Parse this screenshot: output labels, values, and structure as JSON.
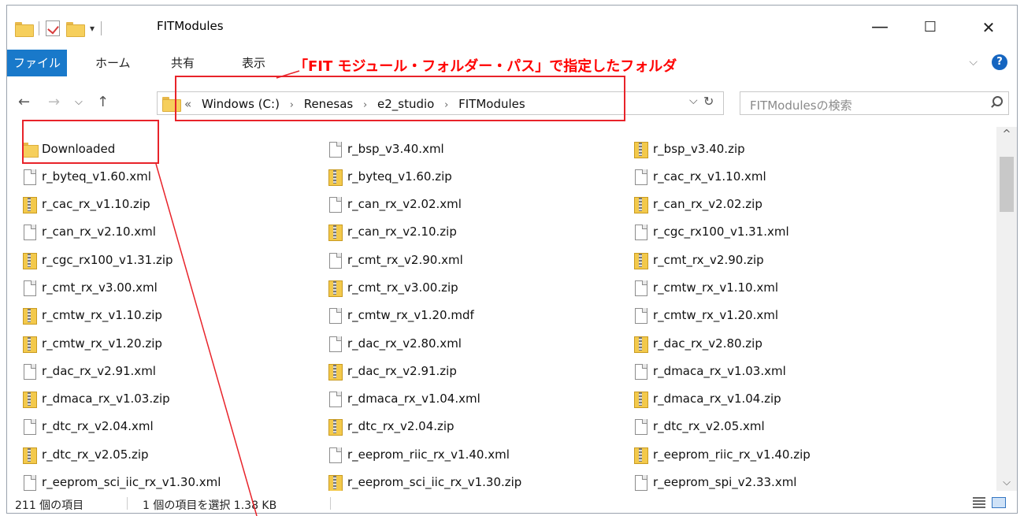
{
  "window": {
    "title": "FITModules",
    "qat_dropdown": "▾",
    "minimize": "—",
    "maximize": "☐",
    "close": "✕"
  },
  "ribbon": {
    "tabs": [
      "ファイル",
      "ホーム",
      "共有",
      "表示"
    ],
    "expand": "⌵",
    "help": "?"
  },
  "nav": {
    "back": "←",
    "forward": "→",
    "recent": "⌵",
    "up": "↑",
    "overflow": "«",
    "crumbs": [
      "Windows (C:)",
      "Renesas",
      "e2_studio",
      "FITModules"
    ],
    "crumb_sep": "›",
    "addr_dropdown": "⌵",
    "refresh": "↻"
  },
  "search": {
    "placeholder": "FITModulesの検索"
  },
  "files": [
    {
      "name": "Downloaded",
      "type": "folder"
    },
    {
      "name": "r_bsp_v3.40.xml",
      "type": "xml"
    },
    {
      "name": "r_bsp_v3.40.zip",
      "type": "zip"
    },
    {
      "name": "r_byteq_v1.60.xml",
      "type": "xml"
    },
    {
      "name": "r_byteq_v1.60.zip",
      "type": "zip"
    },
    {
      "name": "r_cac_rx_v1.10.xml",
      "type": "xml"
    },
    {
      "name": "r_cac_rx_v1.10.zip",
      "type": "zip"
    },
    {
      "name": "r_can_rx_v2.02.xml",
      "type": "xml"
    },
    {
      "name": "r_can_rx_v2.02.zip",
      "type": "zip"
    },
    {
      "name": "r_can_rx_v2.10.xml",
      "type": "xml"
    },
    {
      "name": "r_can_rx_v2.10.zip",
      "type": "zip"
    },
    {
      "name": "r_cgc_rx100_v1.31.xml",
      "type": "xml"
    },
    {
      "name": "r_cgc_rx100_v1.31.zip",
      "type": "zip"
    },
    {
      "name": "r_cmt_rx_v2.90.xml",
      "type": "xml"
    },
    {
      "name": "r_cmt_rx_v2.90.zip",
      "type": "zip"
    },
    {
      "name": "r_cmt_rx_v3.00.xml",
      "type": "xml"
    },
    {
      "name": "r_cmt_rx_v3.00.zip",
      "type": "zip"
    },
    {
      "name": "r_cmtw_rx_v1.10.xml",
      "type": "xml"
    },
    {
      "name": "r_cmtw_rx_v1.10.zip",
      "type": "zip"
    },
    {
      "name": "r_cmtw_rx_v1.20.mdf",
      "type": "xml"
    },
    {
      "name": "r_cmtw_rx_v1.20.xml",
      "type": "xml"
    },
    {
      "name": "r_cmtw_rx_v1.20.zip",
      "type": "zip"
    },
    {
      "name": "r_dac_rx_v2.80.xml",
      "type": "xml"
    },
    {
      "name": "r_dac_rx_v2.80.zip",
      "type": "zip"
    },
    {
      "name": "r_dac_rx_v2.91.xml",
      "type": "xml"
    },
    {
      "name": "r_dac_rx_v2.91.zip",
      "type": "zip"
    },
    {
      "name": "r_dmaca_rx_v1.03.xml",
      "type": "xml"
    },
    {
      "name": "r_dmaca_rx_v1.03.zip",
      "type": "zip"
    },
    {
      "name": "r_dmaca_rx_v1.04.xml",
      "type": "xml"
    },
    {
      "name": "r_dmaca_rx_v1.04.zip",
      "type": "zip"
    },
    {
      "name": "r_dtc_rx_v2.04.xml",
      "type": "xml"
    },
    {
      "name": "r_dtc_rx_v2.04.zip",
      "type": "zip"
    },
    {
      "name": "r_dtc_rx_v2.05.xml",
      "type": "xml"
    },
    {
      "name": "r_dtc_rx_v2.05.zip",
      "type": "zip"
    },
    {
      "name": "r_eeprom_riic_rx_v1.40.xml",
      "type": "xml"
    },
    {
      "name": "r_eeprom_riic_rx_v1.40.zip",
      "type": "zip"
    },
    {
      "name": "r_eeprom_sci_iic_rx_v1.30.xml",
      "type": "xml"
    },
    {
      "name": "r_eeprom_sci_iic_rx_v1.30.zip",
      "type": "zip"
    },
    {
      "name": "r_eeprom_spi_v2.33.xml",
      "type": "xml"
    }
  ],
  "status": {
    "count": "211 個の項目",
    "selection": "1 個の項目を選択  1.38 KB"
  },
  "scroll": {
    "up": "^",
    "down": "⌵"
  },
  "annotation": {
    "text": "「FIT モジュール・フォルダー・パス」で指定したフォルダ",
    "color": "#ff0000"
  },
  "colors": {
    "file_tab": "#1979ca",
    "folder": "#f6cf5c",
    "annotation": "#e8232a"
  }
}
